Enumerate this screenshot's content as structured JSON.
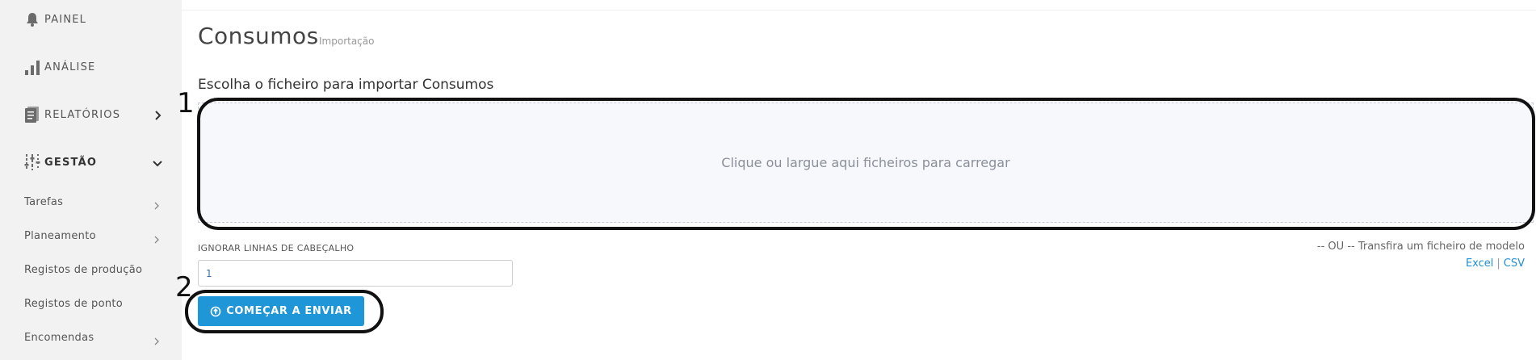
{
  "sidebar": {
    "items": [
      {
        "label": "PAINEL",
        "icon": "bell-icon"
      },
      {
        "label": "ANÁLISE",
        "icon": "bar-chart-icon"
      },
      {
        "label": "RELATÓRIOS",
        "icon": "report-icon"
      },
      {
        "label": "GESTÃO",
        "icon": "sliders-icon"
      }
    ],
    "subitems": [
      {
        "label": "Tarefas"
      },
      {
        "label": "Planeamento"
      },
      {
        "label": "Registos de produção"
      },
      {
        "label": "Registos de ponto"
      },
      {
        "label": "Encomendas"
      }
    ]
  },
  "main": {
    "title": "Consumos",
    "subtitle": "Importação",
    "choose_label": "Escolha o ficheiro para importar Consumos",
    "dropzone_hint": "Clique ou largue aqui ficheiros para carregar",
    "header_lines_label": "IGNORAR LINHAS DE CABEÇALHO",
    "header_lines_value": "1",
    "model_text": "-- OU -- Transfira um ficheiro de modelo",
    "model_excel": "Excel",
    "model_sep": "|",
    "model_csv": "CSV",
    "start_button": "COMEÇAR A ENVIAR"
  },
  "annotations": {
    "one": "1",
    "two": "2"
  },
  "colors": {
    "sidebar_bg": "#f2f2f2",
    "accent": "#1e96d8",
    "link": "#1f8fd6",
    "dropzone_bg": "#f7f8fc"
  }
}
